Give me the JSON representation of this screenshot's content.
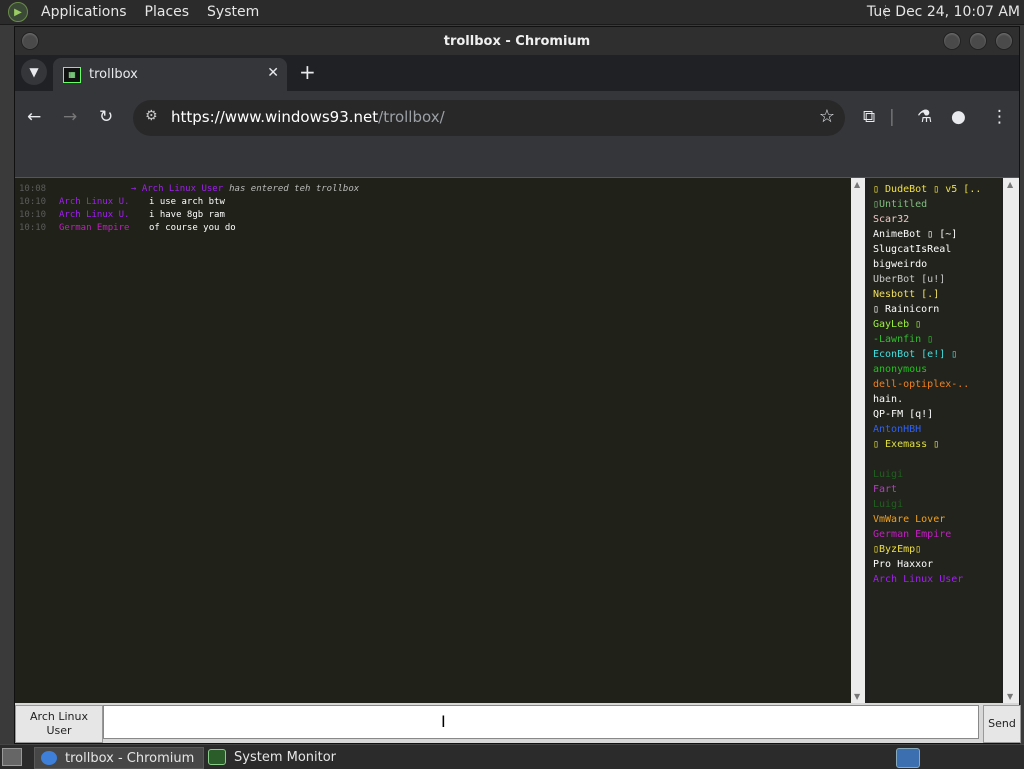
{
  "top_panel": {
    "menus": [
      "Applications",
      "Places",
      "System"
    ],
    "clock": "Tue Dec 24, 10:07 AM"
  },
  "window": {
    "title": "trollbox - Chromium"
  },
  "browser": {
    "tab_title": "trollbox",
    "url_host": "https://www.windows93.net",
    "url_path": "/trollbox/"
  },
  "chat": {
    "messages": [
      {
        "time": "10:08",
        "nick": "→  Arch Linux User",
        "text": "has entered teh trollbox",
        "nick_color": "#a020f0",
        "system": true
      },
      {
        "time": "10:10",
        "nick": "Arch Linux U.",
        "text": "i use arch btw",
        "nick_color": "#a020f0"
      },
      {
        "time": "10:10",
        "nick": "Arch Linux U.",
        "text": "i have 8gb ram",
        "nick_color": "#a020f0"
      },
      {
        "time": "10:10",
        "nick": "German Empire",
        "text": "of course you do",
        "nick_color": "#c020c0"
      }
    ]
  },
  "users": [
    {
      "name": "▯ DudeBot ▯ v5 [..",
      "color": "#f0e040"
    },
    {
      "name": "▯Untitled",
      "color": "#7fbf7f"
    },
    {
      "name": "Scar32",
      "color": "#f0c8c8"
    },
    {
      "name": "AnimeBot ▯ [~]",
      "color": "#ffffff"
    },
    {
      "name": "SlugcatIsReal",
      "color": "#ffffff"
    },
    {
      "name": "bigweirdo",
      "color": "#ffffff"
    },
    {
      "name": "UberBot [u!]",
      "color": "#c8c8c8"
    },
    {
      "name": "Nesbott [.]",
      "color": "#f0e060"
    },
    {
      "name": "▯ Rainicorn",
      "color": "#ffffff"
    },
    {
      "name": "GayLeb ▯",
      "color": "#9cf040"
    },
    {
      "name": "-Lawnfin ▯",
      "color": "#2fbf2f"
    },
    {
      "name": "EconBot [e!] ▯",
      "color": "#40e0e0"
    },
    {
      "name": "anonymous",
      "color": "#20c020"
    },
    {
      "name": "dell-optiplex-..",
      "color": "#f08020"
    },
    {
      "name": "hain.",
      "color": "#ffffff"
    },
    {
      "name": "QP-FM [q!]",
      "color": "#ffffff"
    },
    {
      "name": "AntonHBH",
      "color": "#3060f0"
    },
    {
      "name": "▯ Exemass ▯",
      "color": "#e0e040"
    },
    {
      "name": "",
      "color": "#6a1a8a"
    },
    {
      "name": "Luigi",
      "color": "#206020"
    },
    {
      "name": "Fart",
      "color": "#b040c0"
    },
    {
      "name": "Luigi",
      "color": "#206020"
    },
    {
      "name": "VmWare Lover",
      "color": "#f0a020"
    },
    {
      "name": "German Empire",
      "color": "#c020c0"
    },
    {
      "name": "▯ByzEmp▯",
      "color": "#f0e040"
    },
    {
      "name": "Pro Haxxor",
      "color": "#ffffff"
    },
    {
      "name": "Arch Linux User",
      "color": "#a020f0"
    }
  ],
  "input": {
    "nick": "Arch Linux User",
    "message": "",
    "send_label": "Send"
  },
  "taskbar": {
    "items": [
      "trollbox - Chromium",
      "System Monitor"
    ]
  }
}
